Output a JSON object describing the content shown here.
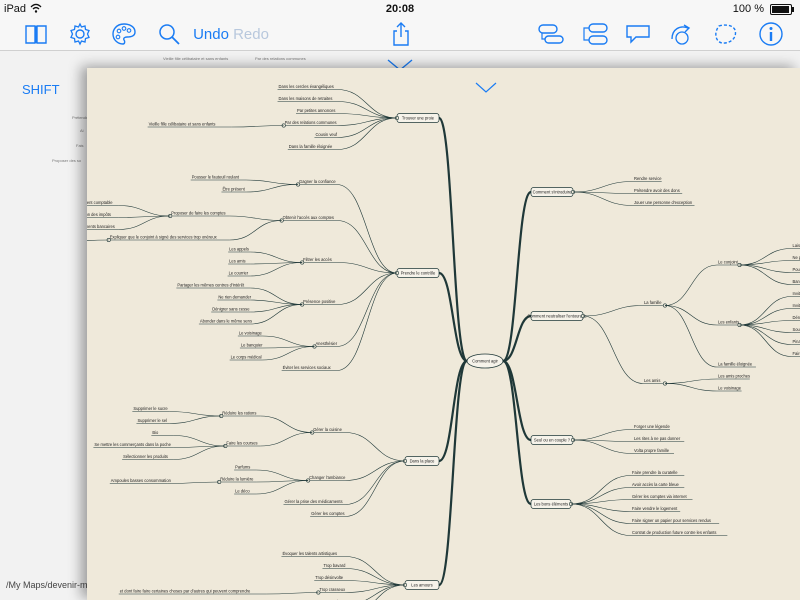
{
  "status": {
    "device": "iPad",
    "time": "20:08",
    "battery": "100 %",
    "battery_level": 1.0
  },
  "toolbar": {
    "undo": "Undo",
    "redo": "Redo"
  },
  "shift_label": "SHIFT",
  "file_path": "/My Maps/devenir-m",
  "back_ghost": [
    "Vieille fille célibataire et sans enfants",
    "Par des relations communes",
    "Prétende",
    "Ai",
    "Fais",
    "Proposer des so"
  ],
  "colors": {
    "accent": "#1a7cf4",
    "branch": "#1f3838",
    "paper": "#efe9da",
    "node_bg": "#f6f3ea"
  },
  "mindmap": {
    "center": "Comment agir",
    "branches": [
      {
        "label": "Trouver une proie",
        "children": [
          {
            "label": "Dans les cercles évangéliques"
          },
          {
            "label": "Dans les maisons de retraites"
          },
          {
            "label": "Par petites annonces"
          },
          {
            "label": "Par des relations communes",
            "children": [
              {
                "label": "Vieille fille célibataire et sans enfants"
              }
            ]
          },
          {
            "label": "Cousin veuf"
          },
          {
            "label": "Dans la famille éloignée"
          }
        ]
      },
      {
        "label": "Prendre le contrôle",
        "children": [
          {
            "label": "Gagner la confiance",
            "children": [
              {
                "label": "Pousser le fauteuil roulant"
              },
              {
                "label": "Être présent"
              }
            ]
          },
          {
            "label": "Obtenir l'accès aux comptes",
            "children": [
              {
                "label": "Proposer de faire les comptes",
                "children": [
                  {
                    "label": "Prétendre être un excellent comptable"
                  },
                  {
                    "label": "Aider à la déclaration des impôts"
                  },
                  {
                    "label": "Faire les rapprochements bancaires"
                  }
                ]
              },
              {
                "label": "Expliquer que le conjoint à signé des services trop onéreux",
                "children": [
                  {
                    "label": "Proposer des solutions plus économiques"
                  }
                ]
              }
            ]
          },
          {
            "label": "Filtrer les accès",
            "children": [
              {
                "label": "Les appels"
              },
              {
                "label": "Les amis"
              },
              {
                "label": "Le courrier"
              }
            ]
          },
          {
            "label": "Présence positive",
            "children": [
              {
                "label": "Partager les mêmes centres d'intérêt"
              },
              {
                "label": "Ne rien demander"
              },
              {
                "label": "Dénigrer sans cesse"
              },
              {
                "label": "Abonder dans le même sens"
              }
            ]
          },
          {
            "label": "Anesthésier",
            "children": [
              {
                "label": "Le voisinage"
              },
              {
                "label": "Le banquier"
              },
              {
                "label": "Le corps médical"
              }
            ]
          },
          {
            "label": "Éviter les services sociaux"
          }
        ]
      },
      {
        "label": "Dans la place",
        "children": [
          {
            "label": "Gérer la cuisine",
            "children": [
              {
                "label": "Réduire les rations",
                "children": [
                  {
                    "label": "Supprimer le sucre"
                  },
                  {
                    "label": "Supprimer le sel"
                  }
                ]
              },
              {
                "label": "Faire les courses",
                "children": [
                  {
                    "label": "Bio"
                  },
                  {
                    "label": "Se mettre les commerçants dans la poche"
                  },
                  {
                    "label": "Sélectionner les produits"
                  }
                ]
              }
            ]
          },
          {
            "label": "Changer l'ambiance",
            "children": [
              {
                "label": "Parfums"
              },
              {
                "label": "Réduire la lumière",
                "children": [
                  {
                    "label": "Ampoules basses consommation"
                  }
                ]
              },
              {
                "label": "Le déco"
              }
            ]
          },
          {
            "label": "Gérer la prise des médicaments"
          },
          {
            "label": "Gérer les comptes"
          }
        ]
      },
      {
        "label": "Les amours",
        "children": [
          {
            "label": "Évoquer les talents artistiques"
          },
          {
            "label": "Trop bavard"
          },
          {
            "label": "Trop désinvolte"
          },
          {
            "label": "Trop crasseux",
            "children": [
              {
                "label": "et dont faire faire certaines choses par d'autres qui peuvent comprendre"
              }
            ]
          },
          {
            "label": "Trop envieux"
          },
          {
            "label": "Trop pétaris"
          }
        ]
      },
      {
        "label": "Comment s'introduire",
        "children": [
          {
            "label": "Rendre service"
          },
          {
            "label": "Prétendre avoir des dons"
          },
          {
            "label": "Jouer une personne d'exception"
          }
        ]
      },
      {
        "label": "Comment neutraliser l'entourage",
        "children": [
          {
            "label": "La famille",
            "children": [
              {
                "label": "Le conjoint",
                "children": [
                  {
                    "label": "Laisser les problèmes s'intensifier"
                  },
                  {
                    "label": "Ne pas agir pour soulager"
                  },
                  {
                    "label": "Pousser à une solution externe"
                  },
                  {
                    "label": "Banaliser les troubles"
                  }
                ]
              },
              {
                "label": "Les enfants",
                "children": [
                  {
                    "label": "Inviter sur leur absence"
                  },
                  {
                    "label": "Inviter sur leur supposée avarice"
                  },
                  {
                    "label": "Dénigrer les belles familles"
                  },
                  {
                    "label": "Souligner leur absence en toute occasion"
                  },
                  {
                    "label": "Pinaiser fou et gendre"
                  },
                  {
                    "label": "Faire remarquer les défauts des petits enfants"
                  }
                ]
              },
              {
                "label": "La famille éloignée"
              }
            ]
          },
          {
            "label": "Les amis",
            "children": [
              {
                "label": "Les amis proches"
              },
              {
                "label": "Le voisinage"
              }
            ]
          }
        ]
      },
      {
        "label": "Seul ou en couple ?",
        "children": [
          {
            "label": "Forger une légende"
          },
          {
            "label": "Les rites à ne pas donner"
          },
          {
            "label": "Volta propre famille"
          }
        ]
      },
      {
        "label": "Les bons éléments",
        "children": [
          {
            "label": "Faire prendre la curatelle"
          },
          {
            "label": "Avoir accès la carte bleue"
          },
          {
            "label": "Gérer les comptes via internet"
          },
          {
            "label": "Faire vendre le logement"
          },
          {
            "label": "Faire signer un papier pour services rendus"
          },
          {
            "label": "Contrat de production future contre les enfants"
          }
        ]
      }
    ]
  }
}
